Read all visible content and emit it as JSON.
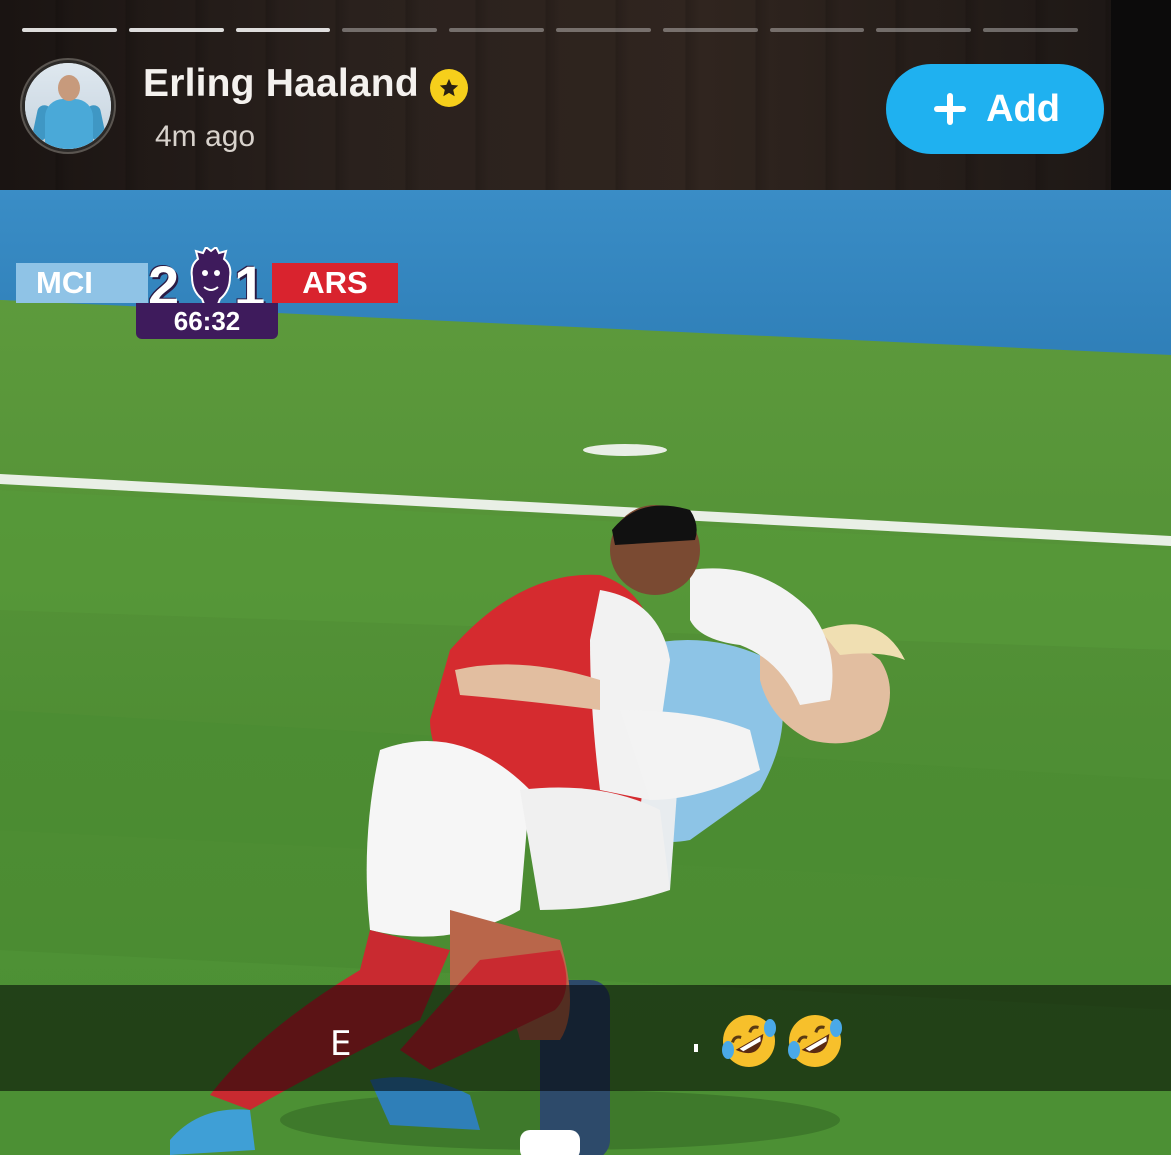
{
  "story": {
    "progress_segments": 10,
    "progress_completed": 3,
    "user_name": "Erling Haaland",
    "time_ago": "4m ago",
    "add_button_label": "Add",
    "icons": {
      "avatar": "profile-avatar",
      "badge": "gold-star-badge",
      "add": "plus-icon"
    },
    "colors": {
      "add_button": "#1fb1f0",
      "badge": "#f6cf1b"
    }
  },
  "scoreboard": {
    "home_team": "MCI",
    "home_score": "2",
    "away_score": "1",
    "away_team": "ARS",
    "match_clock": "66:32",
    "colors": {
      "home": "#8fc3e6",
      "away": "#d9232e",
      "clock": "#3e1b5c"
    }
  },
  "caption": {
    "text": "E",
    "emoji": [
      "rolling-on-the-floor-laughing",
      "rolling-on-the-floor-laughing"
    ]
  }
}
